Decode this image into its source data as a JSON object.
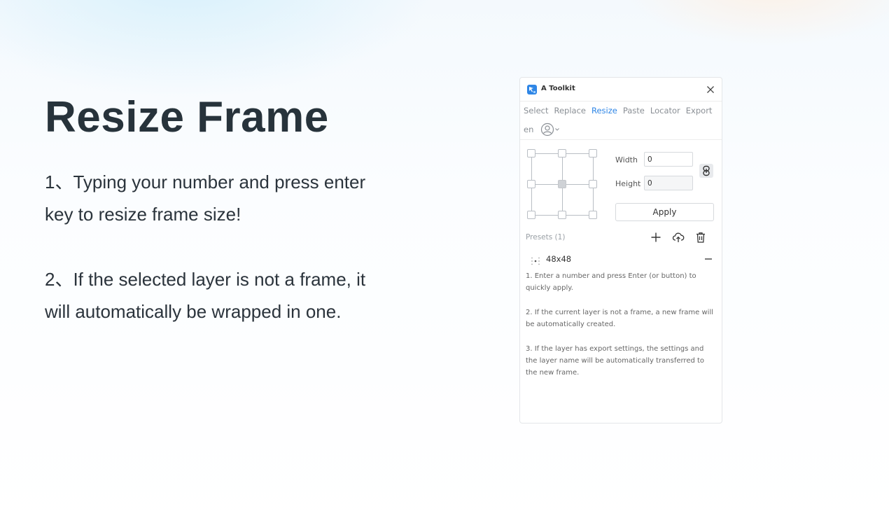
{
  "hero": {
    "title": "Resize Frame",
    "paragraph1": "1、Typing your number and press enter key to resize frame size!",
    "paragraph2": "2、If the selected layer is not a frame, it will automatically be wrapped in one."
  },
  "plugin": {
    "title": "A Toolkit",
    "tabs": [
      "Select",
      "Replace",
      "Resize",
      "Paste",
      "Locator",
      "Export"
    ],
    "active_tab": "Resize",
    "language": "en",
    "width_label": "Width",
    "width_value": "0",
    "height_label": "Height",
    "height_value": "0",
    "apply_label": "Apply",
    "presets_label": "Presets (1)",
    "presets": [
      {
        "name": "48x48"
      }
    ],
    "help": [
      "1. Enter a number and press Enter (or button) to quickly apply.",
      "2. If the current layer is not a frame, a new frame will be automatically created.",
      "3. If the layer has export settings, the settings and the layer name will be automatically transferred to the new frame."
    ]
  },
  "colors": {
    "accent": "#2f86e6",
    "heading": "#27333b",
    "tab_inactive": "#8a8f95"
  }
}
